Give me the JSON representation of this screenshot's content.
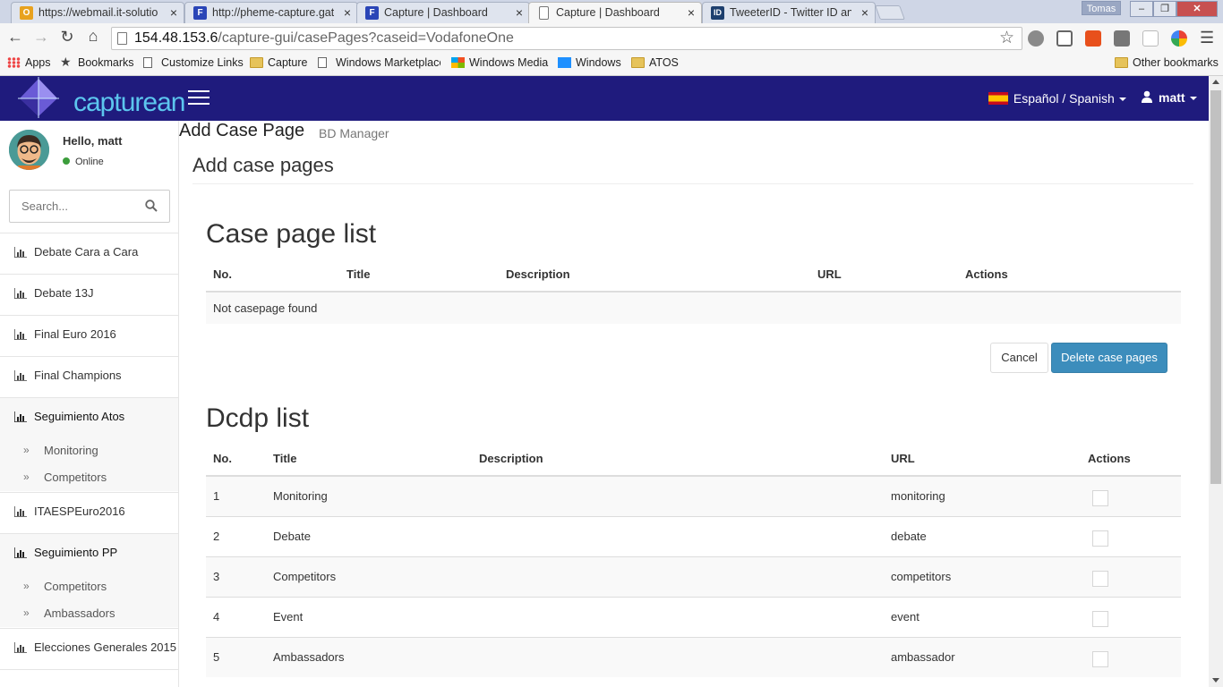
{
  "browser": {
    "tabs": [
      {
        "title": "https://webmail.it-solutio",
        "icon_color": "#e8a21f",
        "icon_glyph": "O"
      },
      {
        "title": "http://pheme-capture.gat",
        "icon_color": "#2a45b7",
        "icon_glyph": "F"
      },
      {
        "title": "Capture | Dashboard",
        "icon_color": "#2a45b7",
        "icon_glyph": "F"
      },
      {
        "title": "Capture | Dashboard",
        "icon_color": "#ffffff",
        "icon_glyph": ""
      },
      {
        "title": "TweeterID - Twitter ID anc",
        "icon_color": "#1d3f6e",
        "icon_glyph": "ID"
      }
    ],
    "window_user": "Tomas",
    "url_host": "154.48.153.6",
    "url_path": "/capture-gui/casePages?caseid=VodafoneOne",
    "bookmarks": [
      "Apps",
      "Bookmarks",
      "Customize Links",
      "Capture",
      "Windows Marketplace",
      "Windows Media",
      "Windows",
      "ATOS"
    ],
    "other_bookmarks": "Other bookmarks"
  },
  "header": {
    "logo_text": "capturean",
    "language": "Español / Spanish",
    "user": "matt"
  },
  "sidebar": {
    "greeting": "Hello, matt",
    "status": "Online",
    "search_placeholder": "Search...",
    "items": [
      {
        "label": "Debate Cara a Cara"
      },
      {
        "label": "Debate 13J"
      },
      {
        "label": "Final Euro 2016"
      },
      {
        "label": "Final Champions"
      },
      {
        "label": "Seguimiento Atos",
        "children": [
          "Monitoring",
          "Competitors"
        ]
      },
      {
        "label": "ITAESPEuro2016"
      },
      {
        "label": "Seguimiento PP",
        "children": [
          "Competitors",
          "Ambassadors"
        ]
      },
      {
        "label": "Elecciones Generales 2015"
      }
    ]
  },
  "main": {
    "page_title": "Add Case Page",
    "page_subtitle": "BD Manager",
    "box_title": "Add case pages",
    "case_list": {
      "heading": "Case page list",
      "columns": [
        "No.",
        "Title",
        "Description",
        "URL",
        "Actions"
      ],
      "empty_text": "Not casepage found"
    },
    "cancel_label": "Cancel",
    "delete_label": "Delete case pages",
    "dcdp_list": {
      "heading": "Dcdp list",
      "columns": [
        "No.",
        "Title",
        "Description",
        "URL",
        "Actions"
      ],
      "rows": [
        {
          "no": "1",
          "title": "Monitoring",
          "description": "",
          "url": "monitoring"
        },
        {
          "no": "2",
          "title": "Debate",
          "description": "",
          "url": "debate"
        },
        {
          "no": "3",
          "title": "Competitors",
          "description": "",
          "url": "competitors"
        },
        {
          "no": "4",
          "title": "Event",
          "description": "",
          "url": "event"
        },
        {
          "no": "5",
          "title": "Ambassadors",
          "description": "",
          "url": "ambassador"
        }
      ]
    }
  }
}
